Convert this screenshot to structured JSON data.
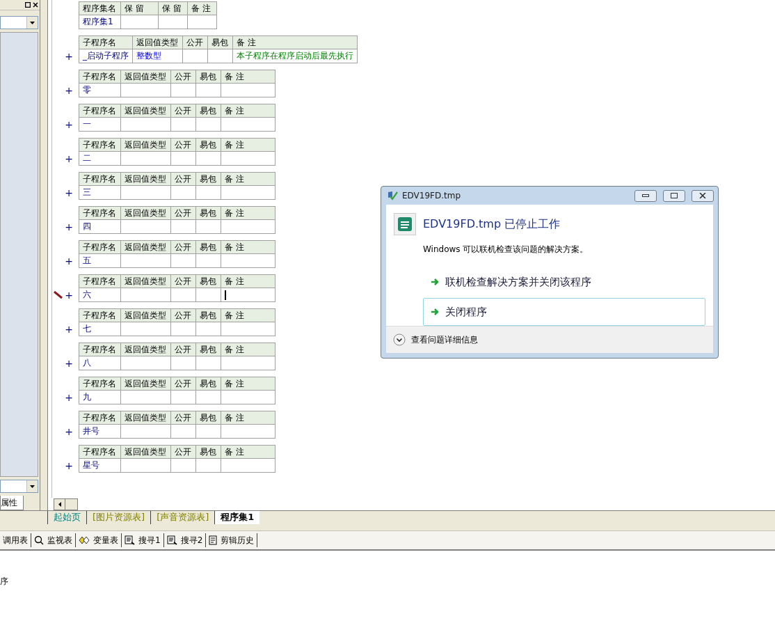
{
  "left_panel": {
    "tab": "属性"
  },
  "assembly": {
    "columns": [
      "程序集名",
      "保 留",
      "保 留",
      "备 注"
    ],
    "name": "程序集1"
  },
  "subroutines": [
    {
      "marker": "+",
      "columns": [
        "子程序名",
        "返回值类型",
        "公开",
        "易包",
        "备 注"
      ],
      "name": "_启动子程序",
      "return_type": "整数型",
      "remark": "本子程序在程序启动后最先执行",
      "editing": false
    },
    {
      "marker": "+",
      "columns": [
        "子程序名",
        "返回值类型",
        "公开",
        "易包",
        "备 注"
      ],
      "name": "零",
      "editing": false
    },
    {
      "marker": "+",
      "columns": [
        "子程序名",
        "返回值类型",
        "公开",
        "易包",
        "备 注"
      ],
      "name": "一",
      "editing": false
    },
    {
      "marker": "+",
      "columns": [
        "子程序名",
        "返回值类型",
        "公开",
        "易包",
        "备 注"
      ],
      "name": "二",
      "editing": false
    },
    {
      "marker": "+",
      "columns": [
        "子程序名",
        "返回值类型",
        "公开",
        "易包",
        "备 注"
      ],
      "name": "三",
      "editing": false
    },
    {
      "marker": "+",
      "columns": [
        "子程序名",
        "返回值类型",
        "公开",
        "易包",
        "备 注"
      ],
      "name": "四",
      "editing": false
    },
    {
      "marker": "+",
      "columns": [
        "子程序名",
        "返回值类型",
        "公开",
        "易包",
        "备 注"
      ],
      "name": "五",
      "editing": false
    },
    {
      "marker": "+",
      "columns": [
        "子程序名",
        "返回值类型",
        "公开",
        "易包",
        "备 注"
      ],
      "name": "六",
      "editing": true
    },
    {
      "marker": "+",
      "columns": [
        "子程序名",
        "返回值类型",
        "公开",
        "易包",
        "备 注"
      ],
      "name": "七",
      "editing": false
    },
    {
      "marker": "+",
      "columns": [
        "子程序名",
        "返回值类型",
        "公开",
        "易包",
        "备 注"
      ],
      "name": "八",
      "editing": false
    },
    {
      "marker": "+",
      "columns": [
        "子程序名",
        "返回值类型",
        "公开",
        "易包",
        "备 注"
      ],
      "name": "九",
      "editing": false
    },
    {
      "marker": "+",
      "columns": [
        "子程序名",
        "返回值类型",
        "公开",
        "易包",
        "备 注"
      ],
      "name": "井号",
      "editing": false
    },
    {
      "marker": "+",
      "columns": [
        "子程序名",
        "返回值类型",
        "公开",
        "易包",
        "备 注"
      ],
      "name": "星号",
      "editing": false
    }
  ],
  "editor_tabs": [
    {
      "label": "起始页",
      "color": "#008080",
      "selected": false
    },
    {
      "label": "[图片资源表]",
      "color": "#808000",
      "selected": false
    },
    {
      "label": "[声音资源表]",
      "color": "#808000",
      "selected": false
    },
    {
      "label": "程序集1",
      "color": "#000000",
      "selected": true
    }
  ],
  "toolbar": [
    {
      "kind": "none",
      "label": "调用表"
    },
    {
      "kind": "search",
      "label": "监视表"
    },
    {
      "kind": "vars",
      "label": "变量表"
    },
    {
      "kind": "find",
      "label": "搜寻1"
    },
    {
      "kind": "find",
      "label": "搜寻2"
    },
    {
      "kind": "clip",
      "label": "剪辑历史"
    }
  ],
  "output": {
    "text": "序"
  },
  "dialog": {
    "title": "EDV19FD.tmp",
    "heading": "EDV19FD.tmp 已停止工作",
    "message": "Windows 可以联机检查该问题的解决方案。",
    "options": [
      {
        "label": "联机检查解决方案并关闭该程序",
        "selected": false
      },
      {
        "label": "关闭程序",
        "selected": true
      }
    ],
    "details": "查看问题详细信息"
  }
}
